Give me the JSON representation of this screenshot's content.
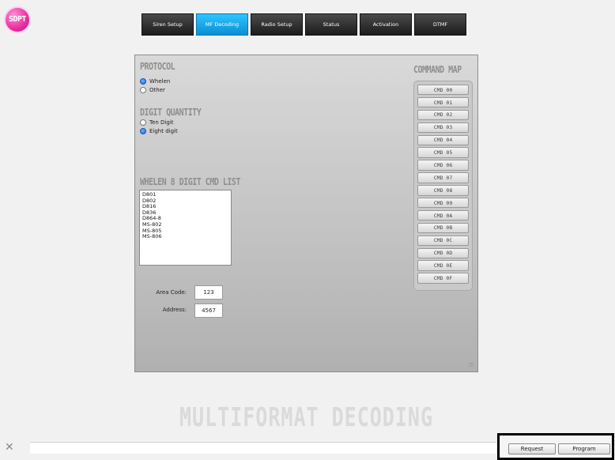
{
  "app": {
    "logo_text": "SDPT"
  },
  "tabs": [
    {
      "label": "Siren Setup",
      "active": false
    },
    {
      "label": "MF Decoding",
      "active": true
    },
    {
      "label": "Radio Setup",
      "active": false
    },
    {
      "label": "Status",
      "active": false
    },
    {
      "label": "Activation",
      "active": false
    },
    {
      "label": "DTMF",
      "active": false
    }
  ],
  "protocol": {
    "heading": "PROTOCOL",
    "options": [
      {
        "label": "Whelen",
        "selected": true
      },
      {
        "label": "Other",
        "selected": false
      }
    ]
  },
  "digit_quantity": {
    "heading": "DIGIT QUANTITY",
    "options": [
      {
        "label": "Ten Digit",
        "selected": false
      },
      {
        "label": "Eight digit",
        "selected": true
      }
    ]
  },
  "cmd_list": {
    "heading": "WHELEN 8 DIGIT CMD LIST",
    "items": [
      "D801",
      "D802",
      "D816",
      "D836",
      "D864-8",
      "MS-802",
      "MS-805",
      "MS-806"
    ]
  },
  "area_code": {
    "label": "Area Code:",
    "value": "123"
  },
  "address": {
    "label": "Address:",
    "value": "4567"
  },
  "command_map": {
    "heading": "COMMAND MAP",
    "buttons": [
      "CMD 00",
      "CMD 01",
      "CMD 02",
      "CMD 03",
      "CMD 04",
      "CMD 05",
      "CMD 06",
      "CMD 07",
      "CMD 08",
      "CMD 09",
      "CMD 0A",
      "CMD 0B",
      "CMD 0C",
      "CMD 0D",
      "CMD 0E",
      "CMD 0F"
    ]
  },
  "watermark": "MULTIFORMAT DECODING",
  "actions": {
    "request": "Request",
    "program": "Program"
  },
  "colors": {
    "active_tab": "#0a8fd4",
    "radio_selected": "#1365d6",
    "logo": "#e8309f"
  }
}
